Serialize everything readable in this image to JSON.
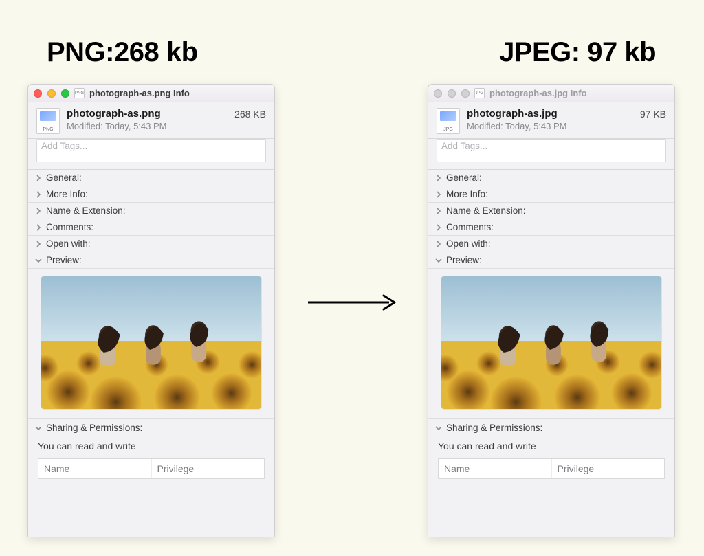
{
  "headings": {
    "left": "PNG:268 kb",
    "right": "JPEG: 97 kb"
  },
  "panels": [
    {
      "id": "left",
      "active": true,
      "window_title": "photograph-as.png Info",
      "doc_icon_badge": "PNG",
      "filename": "photograph-as.png",
      "modified": "Modified: Today, 5:43 PM",
      "filesize": "268 KB",
      "tags_placeholder": "Add Tags...",
      "rows": [
        {
          "label": "General:",
          "expanded": false
        },
        {
          "label": "More Info:",
          "expanded": false
        },
        {
          "label": "Name & Extension:",
          "expanded": false
        },
        {
          "label": "Comments:",
          "expanded": false
        },
        {
          "label": "Open with:",
          "expanded": false
        },
        {
          "label": "Preview:",
          "expanded": true
        }
      ],
      "sharing_label": "Sharing & Permissions:",
      "sharing_desc": "You can read and write",
      "perm_headers": {
        "name": "Name",
        "privilege": "Privilege"
      }
    },
    {
      "id": "right",
      "active": false,
      "window_title": "photograph-as.jpg Info",
      "doc_icon_badge": "JPG",
      "filename": "photograph-as.jpg",
      "modified": "Modified: Today, 5:43 PM",
      "filesize": "97 KB",
      "tags_placeholder": "Add Tags...",
      "rows": [
        {
          "label": "General:",
          "expanded": false
        },
        {
          "label": "More Info:",
          "expanded": false
        },
        {
          "label": "Name & Extension:",
          "expanded": false
        },
        {
          "label": "Comments:",
          "expanded": false
        },
        {
          "label": "Open with:",
          "expanded": false
        },
        {
          "label": "Preview:",
          "expanded": true
        }
      ],
      "sharing_label": "Sharing & Permissions:",
      "sharing_desc": "You can read and write",
      "perm_headers": {
        "name": "Name",
        "privilege": "Privilege"
      }
    }
  ]
}
